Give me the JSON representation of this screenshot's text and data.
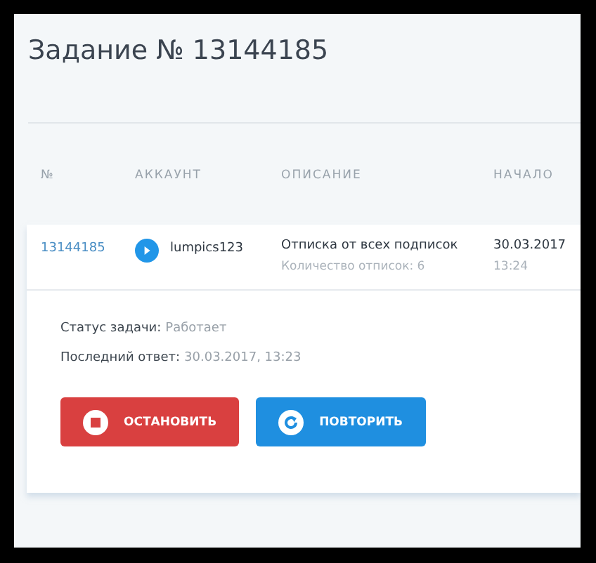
{
  "title": "Задание № 13144185",
  "table": {
    "columns": [
      "№",
      "АККАУНТ",
      "ОПИСАНИЕ",
      "НАЧАЛО"
    ],
    "rows": [
      {
        "id": "13144185",
        "account": "lumpics123",
        "description": "Отписка от всех подписок",
        "detail": "Количество отписок: 6",
        "date": "30.03.2017",
        "time": "13:24"
      }
    ]
  },
  "details": [
    {
      "label": "Статус задачи:",
      "value": "Работает"
    },
    {
      "label": "Последний ответ:",
      "value": "30.03.2017, 13:23"
    }
  ],
  "buttons": [
    {
      "kind": "stop",
      "label": "ОСТАНОВИТЬ"
    },
    {
      "kind": "repeat",
      "label": "ПОВТОРИТЬ"
    }
  ]
}
